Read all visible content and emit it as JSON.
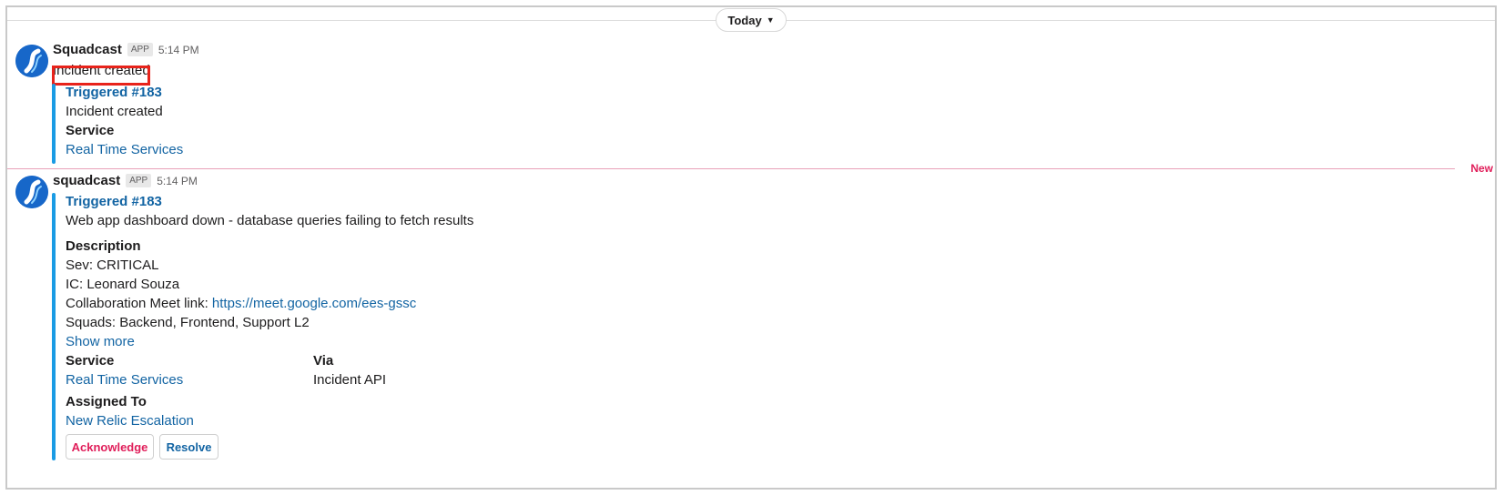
{
  "date_divider": {
    "label": "Today"
  },
  "messages": [
    {
      "sender": "Squadcast",
      "badge": "APP",
      "time": "5:14 PM",
      "text": "Incident created",
      "attachment": {
        "title": "Triggered #183",
        "subtitle": "Incident created",
        "service_label": "Service",
        "service_value": "Real Time Services"
      }
    },
    {
      "sender": "squadcast",
      "badge": "APP",
      "time": "5:14 PM",
      "attachment": {
        "title": "Triggered #183",
        "subtitle": "Web app dashboard down - database queries failing to fetch results",
        "description_label": "Description",
        "sev": "Sev: CRITICAL",
        "ic": "IC: Leonard Souza",
        "meet_prefix": "Collaboration Meet link: ",
        "meet_link": "https://meet.google.com/ees-gssc",
        "squads": "Squads: Backend, Frontend, Support L2",
        "show_more": "Show more",
        "service_label": "Service",
        "service_value": "Real Time Services",
        "via_label": "Via",
        "via_value": "Incident API",
        "assigned_label": "Assigned To",
        "assigned_value": "New Relic Escalation",
        "buttons": {
          "acknowledge": "Acknowledge",
          "resolve": "Resolve"
        }
      }
    }
  ],
  "new_divider": {
    "label": "New"
  },
  "colors": {
    "link": "#1264a3",
    "attachment_bar": "#1a9be4",
    "new_divider": "#e01e5a",
    "highlight_box": "#e8231b",
    "avatar_bg": "#1767c9"
  },
  "icons": {
    "avatar": "squadcast-logo-icon",
    "day_chevron": "chevron-down-icon"
  }
}
